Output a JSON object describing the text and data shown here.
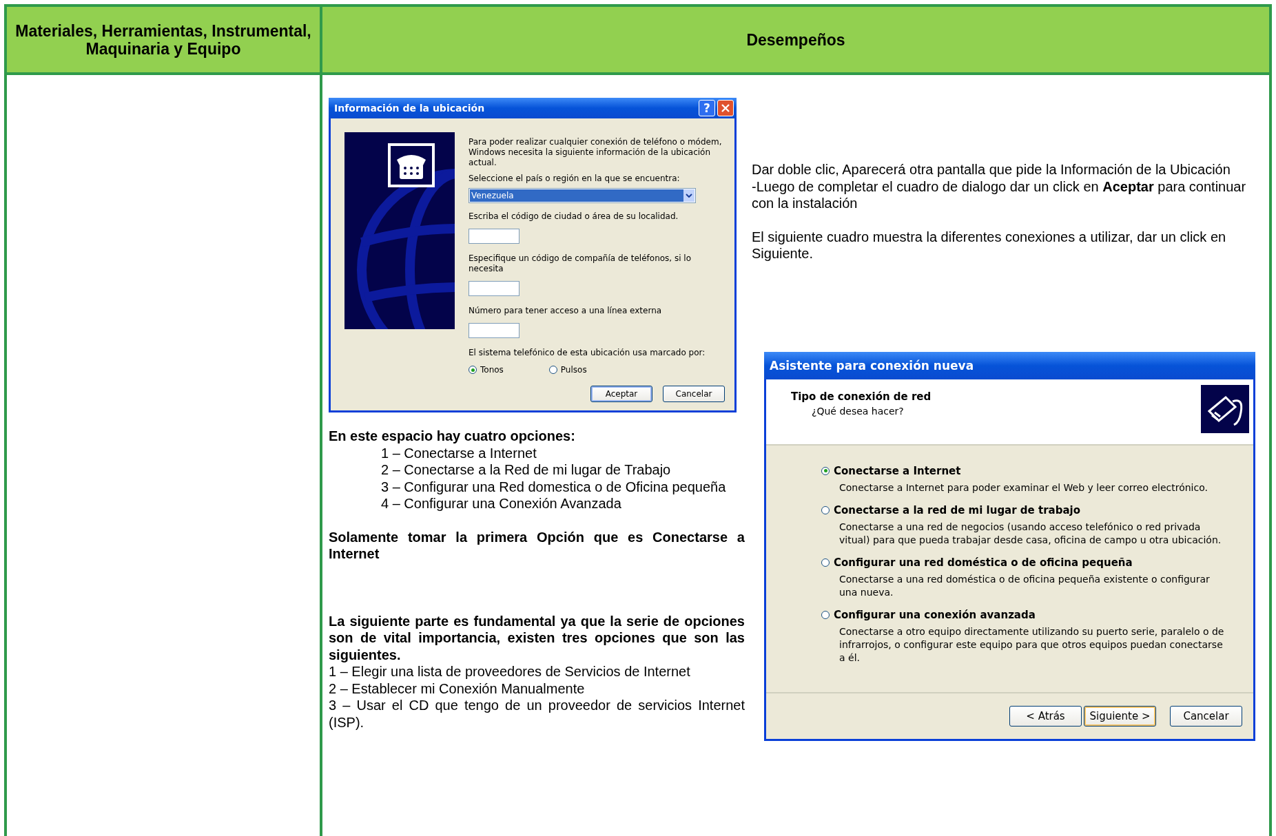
{
  "header": {
    "column_1": "Materiales, Herramientas, Instrumental, Maquinaria y Equipo",
    "column_2": "Desempeños"
  },
  "location_dialog": {
    "title": "Información de la ubicación",
    "help_button": "?",
    "intro": "Para poder realizar cualquier conexión de teléfono o módem, Windows necesita la siguiente información de la ubicación actual.",
    "country_label": "Seleccione el país o región en la que se encuentra:",
    "country_value": "Venezuela",
    "area_code_label": "Escriba el código de ciudad o área de su localidad.",
    "carrier_code_label": "Especifique un código de compañía de teléfonos, si lo necesita",
    "outside_line_label": "Número para tener acceso a una línea externa",
    "dialing_label": "El sistema telefónico de esta ubicación usa marcado por:",
    "dialing_options": [
      {
        "label": "Tonos",
        "selected": true
      },
      {
        "label": "Pulsos",
        "selected": false
      }
    ],
    "buttons": [
      {
        "label": "Aceptar",
        "default": true
      },
      {
        "label": "Cancelar",
        "default": false
      }
    ]
  },
  "left_text": {
    "heading": "En este espacio hay cuatro opciones:",
    "options": [
      "1 – Conectarse a Internet",
      "2 – Conectarse a la Red de mi lugar de Trabajo",
      "3 – Configurar una Red domestica o de Oficina pequeña",
      "4 – Configurar una Conexión Avanzada"
    ],
    "note": "Solamente tomar la primera Opción que es Conectarse a Internet",
    "second_heading": "La siguiente parte es fundamental ya que la serie de opciones son de vital importancia, existen tres opciones que son las siguientes.",
    "second_options": [
      "1 – Elegir una lista de proveedores de Servicios de Internet",
      "2 – Establecer mi Conexión Manualmente",
      "3 – Usar el CD que tengo de un proveedor de servicios Internet (ISP)."
    ]
  },
  "right_text": {
    "paragraphs": [
      "Dar doble clic, Aparecerá otra pantalla que pide la Información de la Ubicación",
      "-Luego de completar el cuadro de dialogo dar un click en **Aceptar** para continuar con la instalación",
      "El siguiente cuadro muestra la diferentes conexiones a utilizar, dar un click en Siguiente."
    ]
  },
  "wizard_dialog": {
    "title": "Asistente para conexión nueva",
    "page_title": "Tipo de conexión de red",
    "page_subtitle": "¿Qué desea hacer?",
    "options": [
      {
        "label": "Conectarse a Internet",
        "description": "Conectarse a Internet para poder examinar el Web y leer correo electrónico.",
        "selected": true
      },
      {
        "label": "Conectarse a la red de mi lugar de trabajo",
        "description": "Conectarse a una red de negocios (usando acceso telefónico o red privada vitual) para que pueda trabajar desde casa, oficina de campo u otra ubicación.",
        "selected": false
      },
      {
        "label": "Configurar una red doméstica o de oficina pequeña",
        "description": "Conectarse a una red doméstica o de oficina pequeña existente o configurar una nueva.",
        "selected": false
      },
      {
        "label": "Configurar una conexión avanzada",
        "description": "Conectarse a otro equipo directamente utilizando su puerto serie, paralelo o de infrarrojos, o configurar este equipo para que otros equipos puedan conectarse a él.",
        "selected": false
      }
    ],
    "buttons": [
      {
        "label": "< Atrás",
        "default": false
      },
      {
        "label": "Siguiente >",
        "default": true
      },
      {
        "label": "Cancelar",
        "default": false
      }
    ]
  }
}
